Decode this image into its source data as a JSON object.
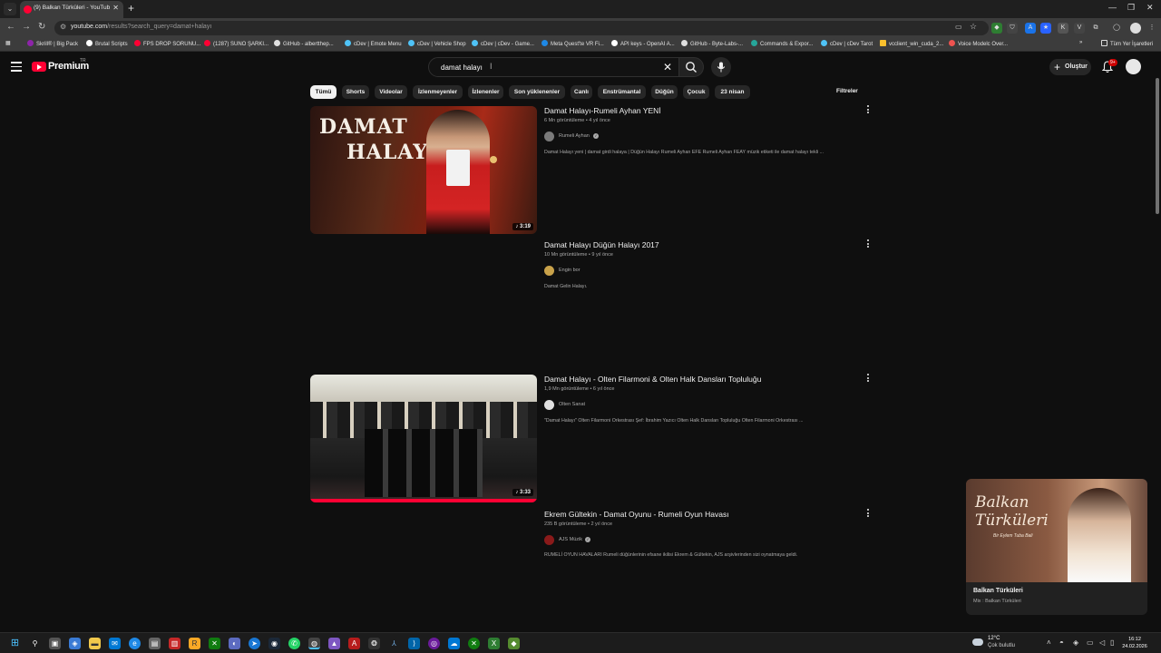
{
  "browser": {
    "tab_title": "(9) Balkan Türküleri - YouTube",
    "url_host": "youtube.com",
    "url_path": "/results?search_query=damat+halayı",
    "bookmarks": [
      "Skrill® | Big Pack",
      "Brutal Scripts",
      "FPS DROP SORUNU...",
      "(1287) SUNO ŞARKI...",
      "GitHub - albertthep...",
      "cDev | Emote Menu",
      "cDev | Vehicle Shop",
      "cDev | cDev - Game...",
      "Meta Quest'te VR Fi...",
      "API keys - OpenAI A...",
      "GitHub - Byte-Labs-...",
      "Commands & Expor...",
      "cDev | cDev Tarot",
      "vcclient_win_cuda_2...",
      "Voice Modelc Over..."
    ],
    "all_bookmarks": "Tüm Yer İşaretleri"
  },
  "youtube": {
    "logo": "Premium",
    "country_code": "TR",
    "search_query": "damat halayı",
    "create_label": "Oluştur",
    "notification_count": "9+",
    "chips": [
      "Tümü",
      "Shorts",
      "Videolar",
      "İzlenmeyenler",
      "İzlenenler",
      "Son yüklenenler",
      "Canlı",
      "Enstrümantal",
      "Düğün",
      "Çocuk",
      "23 nisan"
    ],
    "filters_label": "Filtreler",
    "results": [
      {
        "title": "Damat Halayı-Rumeli Ayhan YENİ",
        "meta": "6 Mn görüntüleme • 4 yıl önce",
        "channel": "Rumeli Ayhan",
        "verified": true,
        "description": "Damat Halayı yeni | damat girdi halaya | Düğün Halayı Rumeli Ayhan EFE Rumeli Ayhan FEAY müzik etiketi ile damat halayı tekli ...",
        "duration": "3:19",
        "thumb_text_1": "DAMAT",
        "thumb_text_2": "HALAYI"
      },
      {
        "title": "Damat Halayı Düğün Halayı 2017",
        "meta": "10 Mn görüntüleme • 9 yıl önce",
        "channel": "Engin bor",
        "verified": false,
        "description": "Damat Gelin Halayı."
      },
      {
        "title": "Damat Halayı - Olten Filarmoni & Olten Halk Dansları Topluluğu",
        "meta": "1,9 Mn görüntüleme • 6 yıl önce",
        "channel": "Olten Sanat",
        "verified": false,
        "description": "\"Damat Halayı\" Olten Filarmoni Orkestrası Şef: İbrahim Yazıcı Olten Halk Dansları Topluluğu Olten Filarmoni Orkestrası ...",
        "duration": "3:33"
      },
      {
        "title": "Ekrem Gültekin - Damat Oyunu - Rumeli Oyun Havası",
        "meta": "235 B görüntüleme • 2 yıl önce",
        "channel": "AJS Müzik",
        "verified": true,
        "description": "RUMELİ OYUN HAVALARI Rumeli düğünlerinin efsane ikilisi Ekrem & Gültekin, AJS arşivlerinden sizi oynatmaya geldi."
      }
    ],
    "miniplayer": {
      "art_title_1": "Balkan",
      "art_title_2": "Türküleri",
      "art_subtitle": "Bir Eylem Tuba Bali",
      "title": "Balkan Türküleri",
      "subtitle": "Mix : Balkan Türküleri"
    }
  },
  "taskbar": {
    "temperature": "12°C",
    "weather": "Çok bulutlu",
    "time": "16:12",
    "date": "24.02.2026"
  },
  "colors": {
    "youtube_red": "#ff0033",
    "background": "#0f0f0f",
    "chip_bg": "#272727",
    "chip_active_bg": "#f1f1f1"
  }
}
